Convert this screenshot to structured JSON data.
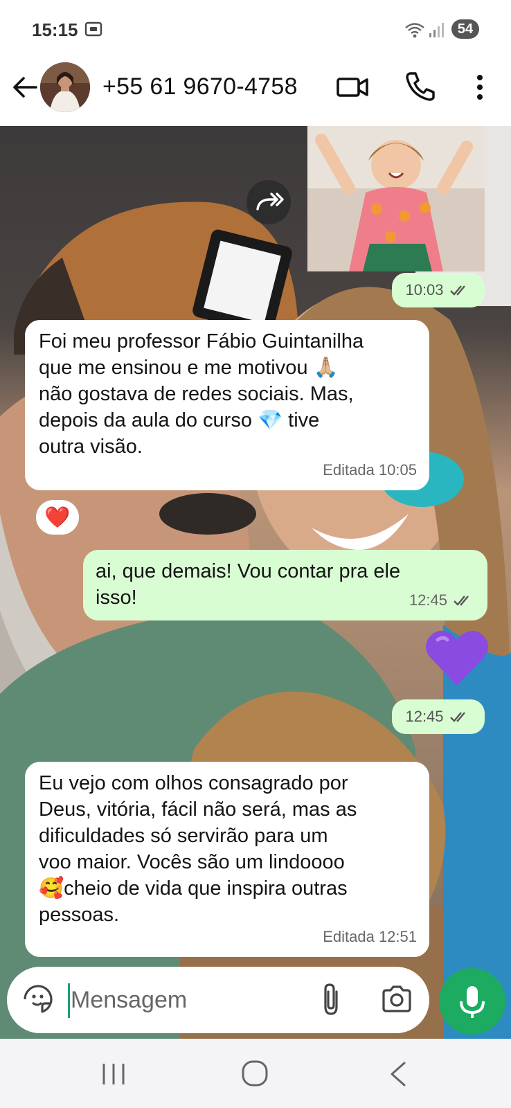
{
  "status_bar": {
    "time": "15:15",
    "battery": "54",
    "icons": [
      "screenshot-icon",
      "wifi-icon",
      "signal-icon",
      "battery-icon"
    ]
  },
  "header": {
    "contact": "+55 61 9670-4758",
    "icons": [
      "back-arrow-icon",
      "avatar",
      "video-call-icon",
      "phone-icon",
      "more-vert-icon"
    ]
  },
  "messages": [
    {
      "type": "image",
      "direction": "out",
      "time": "10:03",
      "status": "read"
    },
    {
      "type": "text",
      "direction": "in",
      "lines": [
        "Foi meu professor Fábio Guintanilha",
        "que me ensinou e me motivou 🙏🏼",
        "não gostava de redes sociais. Mas,",
        "depois da aula do curso 💎 tive",
        "outra visão."
      ],
      "meta": "Editada 10:05",
      "reaction": "❤️"
    },
    {
      "type": "text",
      "direction": "out",
      "lines": [
        "ai, que demais! Vou contar pra ele",
        "isso!"
      ],
      "time": "12:45",
      "status": "read"
    },
    {
      "type": "emoji",
      "direction": "out",
      "emoji": "💜",
      "time": "12:45",
      "status": "read"
    },
    {
      "type": "text",
      "direction": "in",
      "lines": [
        "Eu vejo com olhos consagrado por",
        "Deus, vitória, fácil não será, mas as",
        "dificuldades só servirão para um",
        "voo maior. Vocês são um lindoooo",
        "🥰cheio de vida que inspira outras",
        "pessoas."
      ],
      "meta": "Editada 12:51"
    }
  ],
  "composer": {
    "placeholder": "Mensagem",
    "icons": [
      "sticker-icon",
      "attach-icon",
      "camera-icon",
      "mic-icon"
    ]
  },
  "nav": {
    "icons": [
      "recent-apps-icon",
      "home-icon",
      "back-icon"
    ]
  },
  "colors": {
    "outgoing_bubble": "#d9fdd3",
    "incoming_bubble": "#ffffff",
    "accent": "#1daa61"
  }
}
